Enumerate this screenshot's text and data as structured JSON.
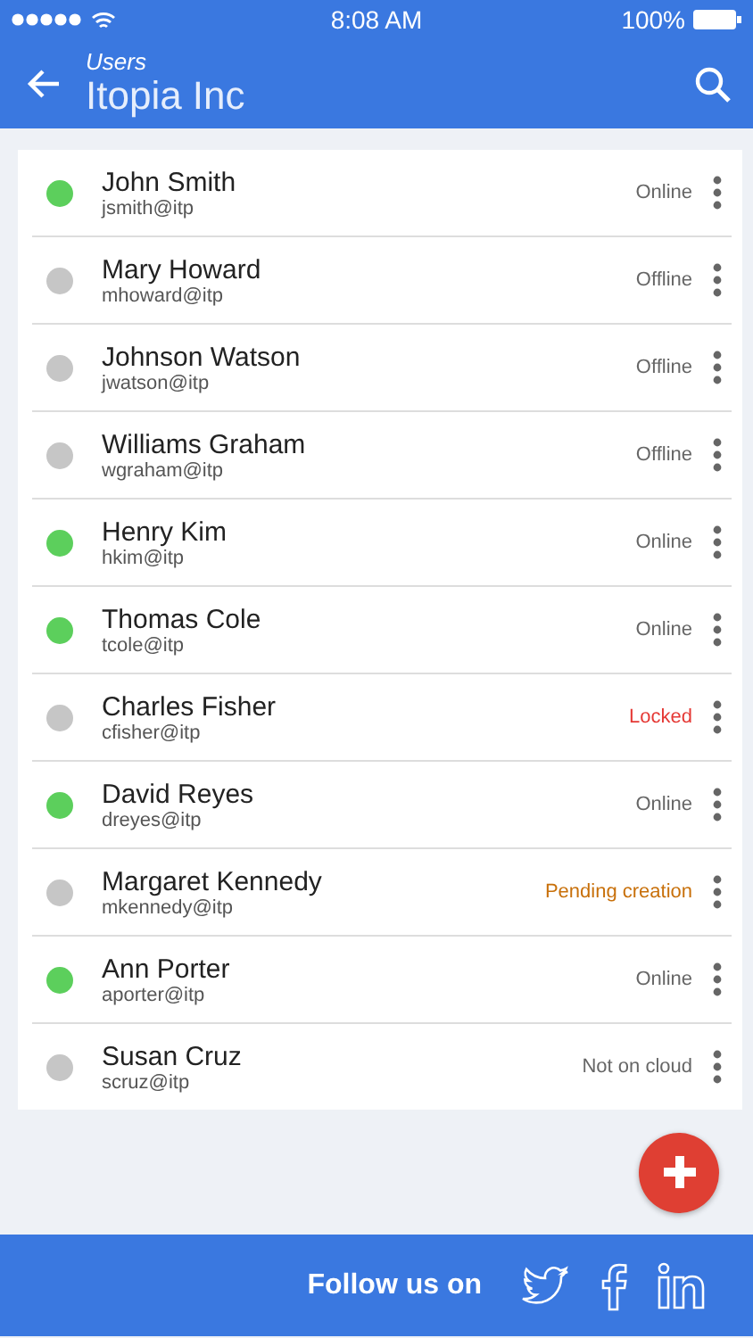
{
  "status_bar": {
    "time": "8:08 AM",
    "battery": "100%"
  },
  "header": {
    "subtitle": "Users",
    "title": "Itopia Inc"
  },
  "users": [
    {
      "name": "John Smith",
      "login": "jsmith@itp",
      "status": "Online",
      "kind": "normal",
      "color": "#5ccf5c"
    },
    {
      "name": "Mary Howard",
      "login": "mhoward@itp",
      "status": "Offline",
      "kind": "normal",
      "color": "#c6c6c6"
    },
    {
      "name": "Johnson Watson",
      "login": "jwatson@itp",
      "status": "Offline",
      "kind": "normal",
      "color": "#c6c6c6"
    },
    {
      "name": "Williams Graham",
      "login": "wgraham@itp",
      "status": "Offline",
      "kind": "normal",
      "color": "#c6c6c6"
    },
    {
      "name": "Henry Kim",
      "login": "hkim@itp",
      "status": "Online",
      "kind": "normal",
      "color": "#5ccf5c"
    },
    {
      "name": "Thomas Cole",
      "login": "tcole@itp",
      "status": "Online",
      "kind": "normal",
      "color": "#5ccf5c"
    },
    {
      "name": "Charles Fisher",
      "login": "cfisher@itp",
      "status": "Locked",
      "kind": "locked",
      "color": "#c6c6c6"
    },
    {
      "name": "David Reyes",
      "login": "dreyes@itp",
      "status": "Online",
      "kind": "normal",
      "color": "#5ccf5c"
    },
    {
      "name": "Margaret Kennedy",
      "login": "mkennedy@itp",
      "status": "Pending creation",
      "kind": "pending",
      "color": "#c6c6c6"
    },
    {
      "name": "Ann Porter",
      "login": "aporter@itp",
      "status": "Online",
      "kind": "normal",
      "color": "#5ccf5c"
    },
    {
      "name": "Susan Cruz",
      "login": "scruz@itp",
      "status": "Not on cloud",
      "kind": "normal",
      "color": "#c6c6c6"
    }
  ],
  "footer": {
    "label": "Follow us on"
  }
}
